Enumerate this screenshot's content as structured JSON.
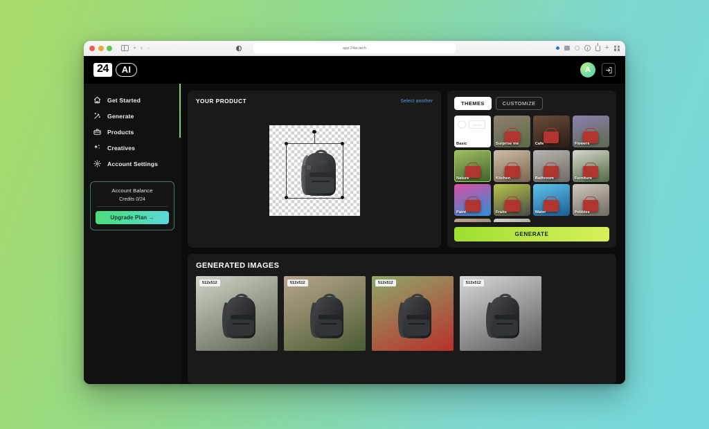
{
  "browser": {
    "url": "app.24ai.tech",
    "traffic_lights": [
      "close",
      "minimize",
      "maximize"
    ],
    "left_icons": [
      "sidebar-toggle-icon",
      "chevron-down-icon",
      "back-chevron-icon",
      "forward-chevron-icon"
    ],
    "right_icons": [
      "extension-icon",
      "extension-icon",
      "extension-icon",
      "downloads-icon",
      "share-icon",
      "new-tab-icon",
      "tab-overview-icon"
    ],
    "contrast_icon": "reader-contrast-icon"
  },
  "app": {
    "logo": {
      "mark": "24",
      "suffix": "AI"
    },
    "avatar_initial": "A",
    "logout_icon": "logout-icon"
  },
  "sidebar": {
    "items": [
      {
        "label": "Get Started",
        "icon": "home-icon"
      },
      {
        "label": "Generate",
        "icon": "magic-wand-icon"
      },
      {
        "label": "Products",
        "icon": "briefcase-icon"
      },
      {
        "label": "Creatives",
        "icon": "sparkles-icon"
      },
      {
        "label": "Account Settings",
        "icon": "gear-icon"
      }
    ],
    "balance": {
      "title": "Account Balance",
      "credits": "Credits 0/24",
      "upgrade_label": "Upgrade Plan →"
    }
  },
  "product": {
    "title": "YOUR PRODUCT",
    "select_another": "Select another",
    "image_alt": "backpack-cutout"
  },
  "themes": {
    "tabs": [
      {
        "label": "THEMES",
        "active": true
      },
      {
        "label": "CUSTOMIZE",
        "active": false
      }
    ],
    "generate_label": "GENERATE",
    "items": [
      {
        "label": "Basic",
        "selected": false,
        "style": "basic"
      },
      {
        "label": "Surprise me",
        "selected": false,
        "c1": "#8d7f6c",
        "c2": "#5d6b4a"
      },
      {
        "label": "Cafe",
        "selected": false,
        "c1": "#6a4d3c",
        "c2": "#2b1d16"
      },
      {
        "label": "Flowers",
        "selected": false,
        "c1": "#8f7fae",
        "c2": "#5a6b4e"
      },
      {
        "label": "Nature",
        "selected": true,
        "c1": "#9fbf63",
        "c2": "#41612c"
      },
      {
        "label": "Kitchen",
        "selected": false,
        "c1": "#cdbda6",
        "c2": "#7a6650"
      },
      {
        "label": "Bathroom",
        "selected": false,
        "c1": "#b9b5ae",
        "c2": "#6e6a66"
      },
      {
        "label": "Furniture",
        "selected": false,
        "c1": "#d8d6cf",
        "c2": "#4e6b42"
      },
      {
        "label": "Paint",
        "selected": false,
        "c1": "#d94fa0",
        "c2": "#2f8fd6"
      },
      {
        "label": "Fruits",
        "selected": false,
        "c1": "#b8c34a",
        "c2": "#4a4a46"
      },
      {
        "label": "Water",
        "selected": false,
        "c1": "#5ec3e8",
        "c2": "#1c5f96"
      },
      {
        "label": "Pebbles",
        "selected": false,
        "c1": "#cfc8bd",
        "c2": "#6f6a62"
      },
      {
        "label": "",
        "selected": false,
        "c1": "#b9a892",
        "c2": "#6d6258"
      },
      {
        "label": "",
        "selected": false,
        "c1": "#d3d3cd",
        "c2": "#6a6f63"
      }
    ]
  },
  "generated": {
    "title": "GENERATED IMAGES",
    "images": [
      {
        "badge": "512x512",
        "scene": "white-flowers-rock",
        "c1": "#cfd4c8",
        "c2": "#5c6450"
      },
      {
        "badge": "512x512",
        "scene": "fallen-log-moss",
        "c1": "#b9a68d",
        "c2": "#4a5c33"
      },
      {
        "badge": "512x512",
        "scene": "red-flowers-garden",
        "c1": "#8fa86a",
        "c2": "#b8302c"
      },
      {
        "badge": "512x512",
        "scene": "black-white-rocks",
        "c1": "#d8d8d8",
        "c2": "#5a5a5a"
      }
    ]
  },
  "colors": {
    "page_bg_from": "#a9db68",
    "page_bg_to": "#74d8dd",
    "accent_green": "#9fe05a",
    "generate_from": "#9ede2f",
    "generate_to": "#d8ef5a",
    "upgrade_from": "#4ade7a",
    "upgrade_to": "#5fd6dd",
    "link_blue": "#5b9ce0"
  }
}
